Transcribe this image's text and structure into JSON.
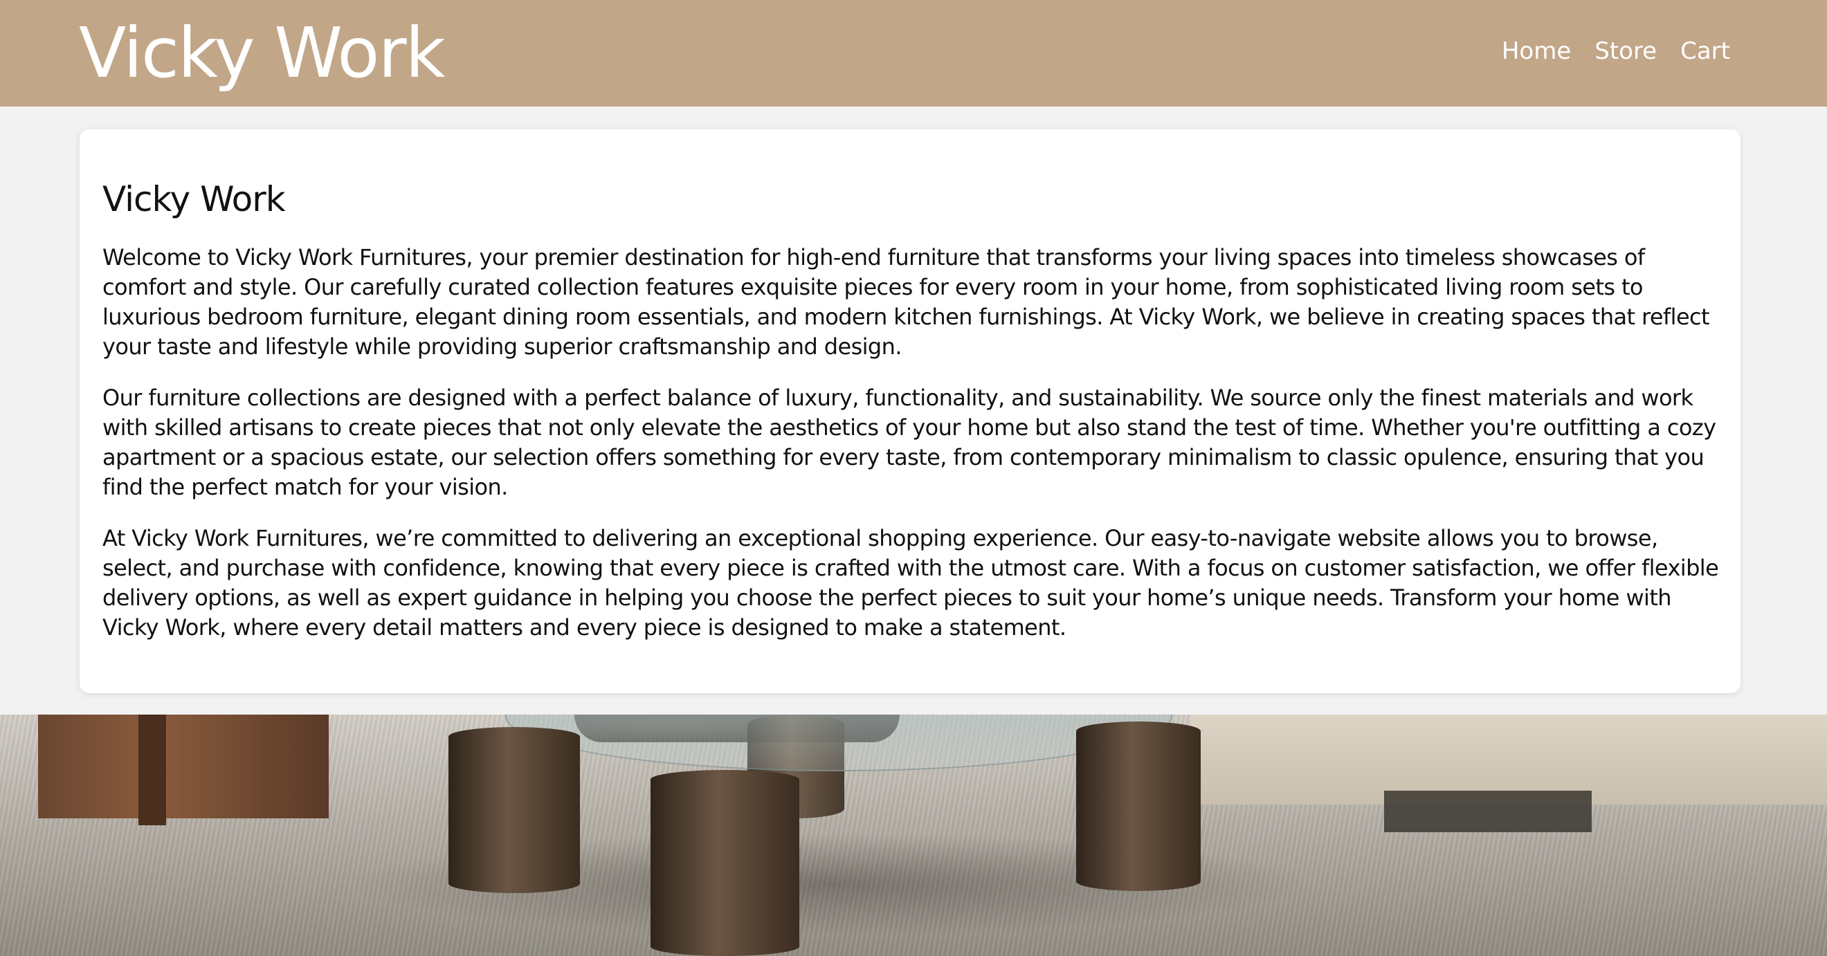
{
  "header": {
    "brand": "Vicky Work",
    "nav": [
      {
        "label": "Home"
      },
      {
        "label": "Store"
      },
      {
        "label": "Cart"
      }
    ]
  },
  "main": {
    "title": "Vicky Work",
    "paragraphs": [
      "Welcome to Vicky Work Furnitures, your premier destination for high-end furniture that transforms your living spaces into timeless showcases of comfort and style. Our carefully curated collection features exquisite pieces for every room in your home, from sophisticated living room sets to luxurious bedroom furniture, elegant dining room essentials, and modern kitchen furnishings. At Vicky Work, we believe in creating spaces that reflect your taste and lifestyle while providing superior craftsmanship and design.",
      "Our furniture collections are designed with a perfect balance of luxury, functionality, and sustainability. We source only the finest materials and work with skilled artisans to create pieces that not only elevate the aesthetics of your home but also stand the test of time. Whether you're outfitting a cozy apartment or a spacious estate, our selection offers something for every taste, from contemporary minimalism to classic opulence, ensuring that you find the perfect match for your vision.",
      "At Vicky Work Furnitures, we’re committed to delivering an exceptional shopping experience. Our easy-to-navigate website allows you to browse, select, and purchase with confidence, knowing that every piece is crafted with the utmost care. With a focus on customer satisfaction, we offer flexible delivery options, as well as expert guidance in helping you choose the perfect pieces to suit your home’s unique needs. Transform your home with Vicky Work, where every detail matters and every piece is designed to make a statement."
    ]
  },
  "colors": {
    "header_bg": "#c1a688",
    "page_bg": "#f2f2f2",
    "card_bg": "#ffffff"
  }
}
